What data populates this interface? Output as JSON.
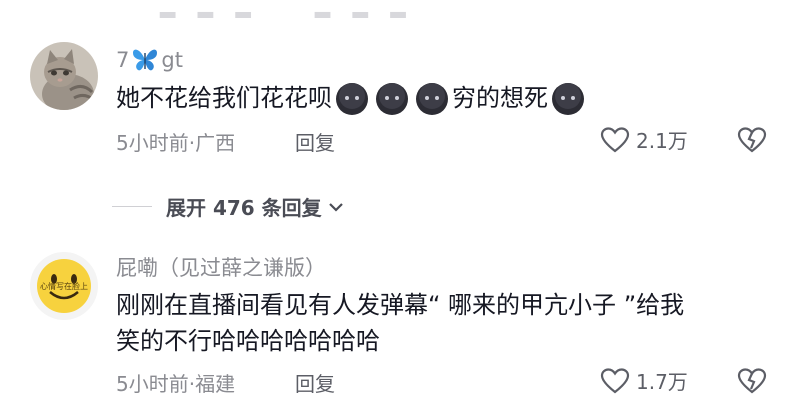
{
  "comments": [
    {
      "username_prefix": "7",
      "username_suffix": "gt",
      "text_part1": "她不花给我们花花呗",
      "text_part2": "穷的想死",
      "time_location": "5小时前·广西",
      "reply_label": "回复",
      "like_count": "2.1万"
    },
    {
      "username": "屁嘞（见过薛之谦版）",
      "avatar_text": "心情写在脸上",
      "text_line1": "刚刚在直播间看见有人发弹幕“ 哪来的甲亢小子 ”给我",
      "text_line2": "笑的不行哈哈哈哈哈哈哈",
      "time_location": "5小时前·福建",
      "reply_label": "回复",
      "like_count": "1.7万"
    }
  ],
  "expand_replies": "展开 476 条回复",
  "icons": {
    "heart": "heart-outline-icon",
    "dislike": "broken-heart-icon",
    "chevron": "chevron-down-icon",
    "emoji": "dark-face-emoji",
    "butterfly": "blue-butterfly-emoji"
  }
}
